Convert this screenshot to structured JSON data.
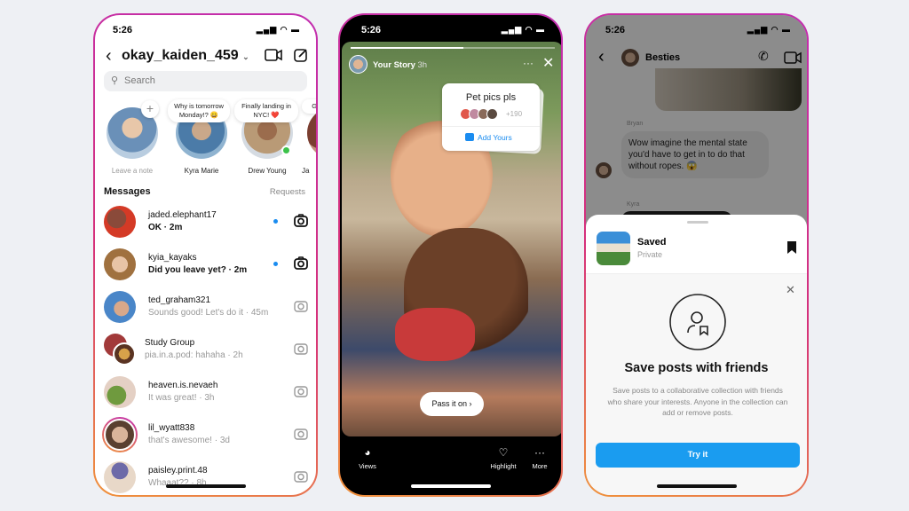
{
  "colors": {
    "accent": "#1a9cf0",
    "ring_start": "#c22eb0",
    "ring_end": "#f0923a",
    "unread_dot": "#1a8cf0"
  },
  "inbox": {
    "status_time": "5:26",
    "title": "okay_kaiden_459",
    "search_placeholder": "Search",
    "notes": [
      {
        "name": "Leave a note",
        "note": ""
      },
      {
        "name": "Kyra Marie",
        "note": "Why is tomorrow Monday!? 😄"
      },
      {
        "name": "Drew Young",
        "note": "Finally landing in NYC! ❤️"
      },
      {
        "name": "Ja",
        "note": "Ga w"
      }
    ],
    "messages_label": "Messages",
    "requests_label": "Requests",
    "threads": [
      {
        "name": "jaded.elephant17",
        "preview": "OK · 2m",
        "unread": true
      },
      {
        "name": "kyia_kayaks",
        "preview": "Did you leave yet? · 2m",
        "unread": true
      },
      {
        "name": "ted_graham321",
        "preview": "Sounds good! Let's do it · 45m",
        "unread": false
      },
      {
        "name": "Study Group",
        "preview": "pia.in.a.pod: hahaha · 2h",
        "unread": false
      },
      {
        "name": "heaven.is.nevaeh",
        "preview": "It was great! · 3h",
        "unread": false
      },
      {
        "name": "lil_wyatt838",
        "preview": "that's awesome! · 3d",
        "unread": false
      },
      {
        "name": "paisley.print.48",
        "preview": "Whaaat?? · 8h",
        "unread": false
      }
    ]
  },
  "story": {
    "status_time": "5:26",
    "owner": "Your Story",
    "age": "3h",
    "progress": 0.55,
    "sticker": {
      "title": "Pet pics pls",
      "count": "+190",
      "action": "Add Yours"
    },
    "pass_label": "Pass it on",
    "bottom": {
      "views": "Views",
      "highlight": "Highlight",
      "more": "More"
    }
  },
  "chat": {
    "status_time": "5:26",
    "title": "Besties",
    "sender1": "Bryan",
    "message1": "Wow imagine the mental state you'd have to get in to do that without ropes. 😱",
    "sender2": "Kyra",
    "sheet": {
      "collection_name": "Saved",
      "collection_privacy": "Private",
      "heading": "Save posts with friends",
      "description": "Save posts to a collaborative collection with friends who share your interests. Anyone in the collection can add or remove posts.",
      "button": "Try it"
    }
  }
}
